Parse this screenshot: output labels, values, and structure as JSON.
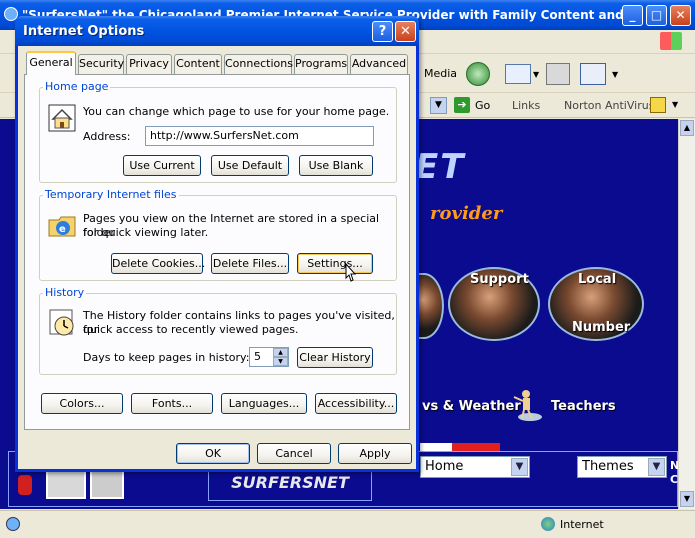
{
  "browser": {
    "title": "\"SurfersNet\" the Chicagoland Premier Internet Service Provider with Family Content and Fas...",
    "toolbar": {
      "media_label": "Media",
      "go_label": "Go",
      "links_label": "Links",
      "norton_label": "Norton AntiVirus"
    },
    "page": {
      "logo_fragment": "ET",
      "tagline_fragment": "rovider",
      "support_label": "Support",
      "local_label": "Local",
      "number_label": "Number",
      "news_weather_label": "vs & Weather",
      "teachers_label": "Teachers",
      "home_select_value": "Home",
      "themes_select_value": "Themes",
      "brand_logo_text": "SURFERSNET",
      "side_letters": [
        "N",
        "C"
      ]
    },
    "status": {
      "zone_label": "Internet"
    }
  },
  "dialog": {
    "title": "Internet Options",
    "help_symbol": "?",
    "close_symbol": "✕",
    "tabs": [
      "General",
      "Security",
      "Privacy",
      "Content",
      "Connections",
      "Programs",
      "Advanced"
    ],
    "active_tab": "General",
    "home_page": {
      "group_title": "Home page",
      "description": "You can change which page to use for your home page.",
      "address_label": "Address:",
      "address_value": "http://www.SurfersNet.com",
      "use_current": "Use Current",
      "use_default": "Use Default",
      "use_blank": "Use Blank"
    },
    "temp_files": {
      "group_title": "Temporary Internet files",
      "description_line1": "Pages you view on the Internet are stored in a special folder",
      "description_line2": "for quick viewing later.",
      "delete_cookies": "Delete Cookies...",
      "delete_files": "Delete Files...",
      "settings": "Settings..."
    },
    "history": {
      "group_title": "History",
      "description_line1": "The History folder contains links to pages you've visited, for",
      "description_line2": "quick access to recently viewed pages.",
      "days_label": "Days to keep pages in history:",
      "days_value": "5",
      "clear_history": "Clear History"
    },
    "bottom_buttons": {
      "colors": "Colors...",
      "fonts": "Fonts...",
      "languages": "Languages...",
      "accessibility": "Accessibility..."
    },
    "footer": {
      "ok": "OK",
      "cancel": "Cancel",
      "apply": "Apply"
    }
  },
  "colors": {
    "xp_title_blue": "#0054e3",
    "page_background": "#0b0b8f",
    "dialog_face": "#ece9d8",
    "group_title_blue": "#0046d5"
  }
}
